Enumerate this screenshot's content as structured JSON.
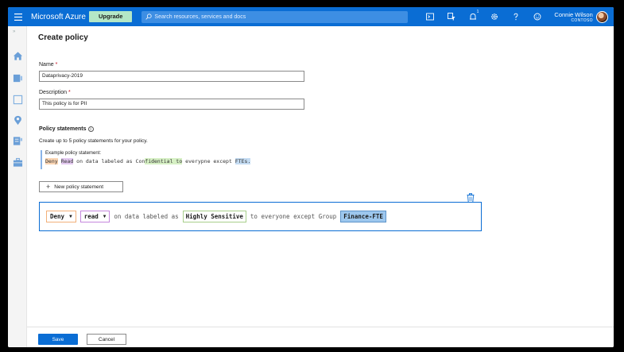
{
  "topbar": {
    "brand": "Microsoft Azure",
    "upgrade_label": "Upgrade",
    "search_placeholder": "Search resources, services and docs",
    "notification_badge": "1",
    "user_name": "Connie Wilson",
    "user_org": "CONTOSO",
    "icons": [
      "cloud-shell-icon",
      "directory-filter-icon",
      "notifications-icon",
      "settings-icon",
      "help-icon",
      "feedback-icon"
    ]
  },
  "sidebar": {
    "icons": [
      "home-icon",
      "dashboard-icon",
      "resources-icon",
      "location-icon",
      "services-icon",
      "briefcase-icon"
    ]
  },
  "page": {
    "title": "Create policy",
    "name_label": "Name",
    "name_value": "Dataprivacy-2019",
    "description_label": "Description",
    "description_value": "This policy is for PII",
    "required_mark": "*",
    "statements_title": "Policy statements",
    "statements_subtitle": "Create up to 5 policy statements for your policy.",
    "example_label": "Example policy statement:",
    "example": {
      "action": "Deny",
      "verb": "Read",
      "text1": "on data labeled as",
      "label_plain": "Con",
      "label_highlight": "fidential to",
      "text2": "everypne except",
      "group": "FTEs."
    },
    "new_statement_label": "New policy statement"
  },
  "statement": {
    "effect": "Deny",
    "permission": "read",
    "text1": "on data labeled as",
    "label": "Highly Sensitive",
    "text2": "to everyone except Group",
    "group": "Finance-FTE"
  },
  "footer": {
    "save_label": "Save",
    "cancel_label": "Cancel"
  },
  "colors": {
    "accent": "#0a6dd4",
    "upgrade_bg": "#b4e7c6"
  }
}
